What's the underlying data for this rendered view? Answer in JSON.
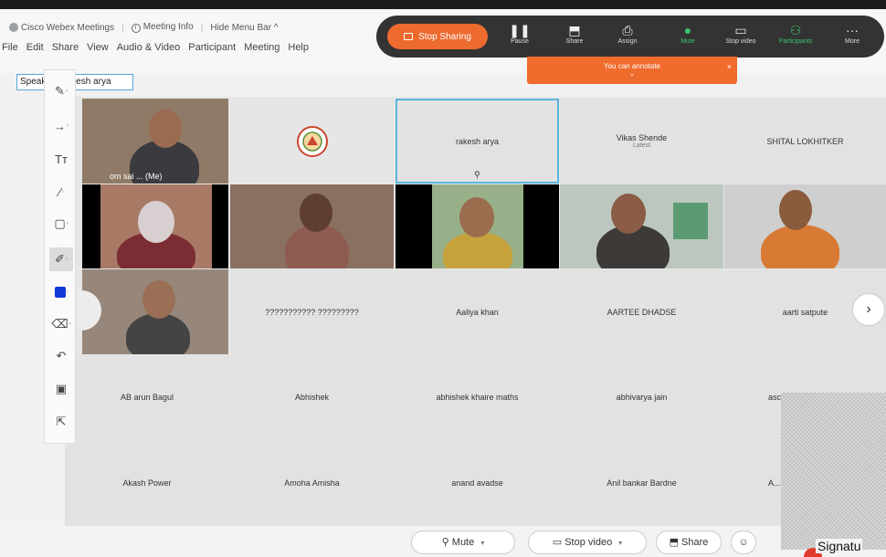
{
  "app": {
    "title": "Cisco Webex Meetings",
    "meeting_info": "Meeting Info",
    "hide_menu": "Hide Menu Bar ^"
  },
  "menu": [
    "File",
    "Edit",
    "Share",
    "View",
    "Audio & Video",
    "Participant",
    "Meeting",
    "Help"
  ],
  "speaker_label": "Speaking: rakesh arya",
  "control_bar": {
    "stop_sharing": "Stop Sharing",
    "buttons": [
      {
        "label": "Pause",
        "icon": "pause-icon",
        "glyph": "❚❚"
      },
      {
        "label": "Share",
        "icon": "share-icon",
        "glyph": "⬒"
      },
      {
        "label": "Assign",
        "icon": "assign-icon",
        "glyph": "⎙"
      },
      {
        "label": "Mute",
        "icon": "mic-icon",
        "glyph": "🎙"
      },
      {
        "label": "Stop video",
        "icon": "video-icon",
        "glyph": "▭"
      },
      {
        "label": "Participants",
        "icon": "participants-icon",
        "glyph": "⚇"
      },
      {
        "label": "More",
        "icon": "more-icon",
        "glyph": "···"
      }
    ],
    "banner": "You can annotate",
    "banner_chevron": "⌄",
    "banner_close": "×"
  },
  "participants": [
    {
      "name": "om sai ... (Me)",
      "type": "video"
    },
    {
      "name": "",
      "type": "logo"
    },
    {
      "name": "rakesh arya",
      "type": "name",
      "active": true
    },
    {
      "name": "Vikas Shende",
      "sub": "Latest",
      "type": "name"
    },
    {
      "name": "SHITAL LOKHITKER",
      "type": "name"
    },
    {
      "name": "",
      "type": "video"
    },
    {
      "name": "",
      "type": "video"
    },
    {
      "name": "",
      "type": "video"
    },
    {
      "name": "",
      "type": "video"
    },
    {
      "name": "",
      "type": "video"
    },
    {
      "name": "",
      "type": "video"
    },
    {
      "name": "??????????? ?????????",
      "type": "name"
    },
    {
      "name": "Aaliya khan",
      "type": "name"
    },
    {
      "name": "AARTEE DHADSE",
      "type": "name"
    },
    {
      "name": "aarti satpute",
      "type": "name"
    },
    {
      "name": "AB arun Bagul",
      "type": "name"
    },
    {
      "name": "Abhishek",
      "type": "name"
    },
    {
      "name": "abhishek khaire maths",
      "type": "name"
    },
    {
      "name": "abhivarya jain",
      "type": "name"
    },
    {
      "name": "asc...",
      "type": "name"
    },
    {
      "name": "Akash Power",
      "type": "name"
    },
    {
      "name": "Amoha Amisha",
      "type": "name"
    },
    {
      "name": "anand avadse",
      "type": "name"
    },
    {
      "name": "Anil bankar Bardne",
      "type": "name"
    },
    {
      "name": "A...",
      "type": "name"
    }
  ],
  "annotation_tools": [
    {
      "icon": "pen-icon",
      "glyph": "✎"
    },
    {
      "icon": "arrow-icon",
      "glyph": "→"
    },
    {
      "icon": "text-icon",
      "glyph": "Tт"
    },
    {
      "icon": "line-icon",
      "glyph": "⁄"
    },
    {
      "icon": "rectangle-icon",
      "glyph": "▢"
    },
    {
      "icon": "highlighter-icon",
      "glyph": "✐"
    },
    {
      "icon": "color-icon",
      "glyph": ""
    },
    {
      "icon": "eraser-icon",
      "glyph": "⌫"
    },
    {
      "icon": "undo-icon",
      "glyph": "↶"
    },
    {
      "icon": "save-icon",
      "glyph": "▣"
    },
    {
      "icon": "pointer-icon",
      "glyph": "⇱"
    }
  ],
  "next_page": "›",
  "bottom_bar": {
    "mute": "Mute",
    "stop_video": "Stop video",
    "share": "Share"
  },
  "signature_text": "Signatu",
  "colors": {
    "accent_orange": "#ee6b2f",
    "active_border": "#58b6df",
    "annotation_color": "#1038d6",
    "control_bar_bg": "#333333"
  }
}
